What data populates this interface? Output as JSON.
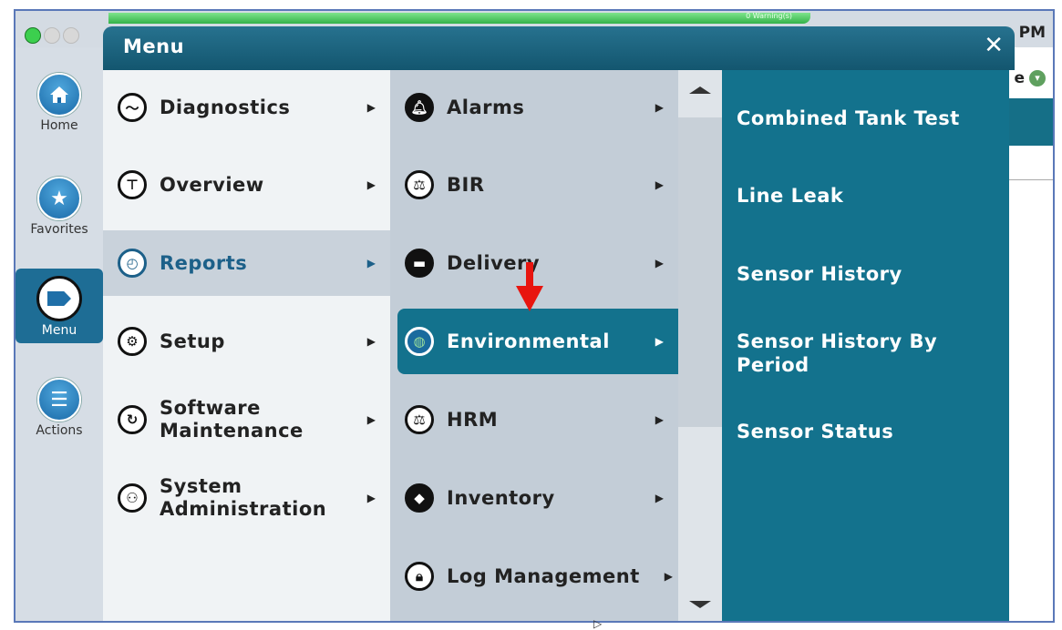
{
  "status": {
    "clock": "PM",
    "right_letter": "e",
    "warning_text": "0 Warning(s)"
  },
  "rail": [
    {
      "label": "Home",
      "icon": "home-icon"
    },
    {
      "label": "Favorites",
      "icon": "star-icon"
    },
    {
      "label": "Menu",
      "icon": "tag-icon",
      "active": true
    },
    {
      "label": "Actions",
      "icon": "list-icon"
    }
  ],
  "menu": {
    "title": "Menu",
    "close": "✕",
    "level1": [
      {
        "label": "Diagnostics",
        "icon": "diagnostics-icon"
      },
      {
        "label": "Overview",
        "icon": "overview-icon"
      },
      {
        "label": "Reports",
        "icon": "clock-icon",
        "selected": true
      },
      {
        "label": "Setup",
        "icon": "gear-icon"
      },
      {
        "label": "Software\nMaintenance",
        "icon": "refresh-icon"
      },
      {
        "label": "System\nAdministration",
        "icon": "admin-icon"
      }
    ],
    "level2": [
      {
        "label": "Alarms",
        "icon": "bell-icon"
      },
      {
        "label": "BIR",
        "icon": "scale-icon"
      },
      {
        "label": "Delivery",
        "icon": "truck-icon"
      },
      {
        "label": "Environmental",
        "icon": "globe-icon",
        "selected": true
      },
      {
        "label": "HRM",
        "icon": "scale-icon"
      },
      {
        "label": "Inventory",
        "icon": "box-icon"
      },
      {
        "label": "Log Management",
        "icon": "lock-icon"
      }
    ],
    "level3": [
      "Combined Tank Test",
      "Line Leak",
      "Sensor History",
      "Sensor History By Period",
      "Sensor Status"
    ]
  },
  "colors": {
    "accent": "#13728d",
    "header": "#1a5f7a",
    "annotation_arrow": "#e8150f"
  }
}
